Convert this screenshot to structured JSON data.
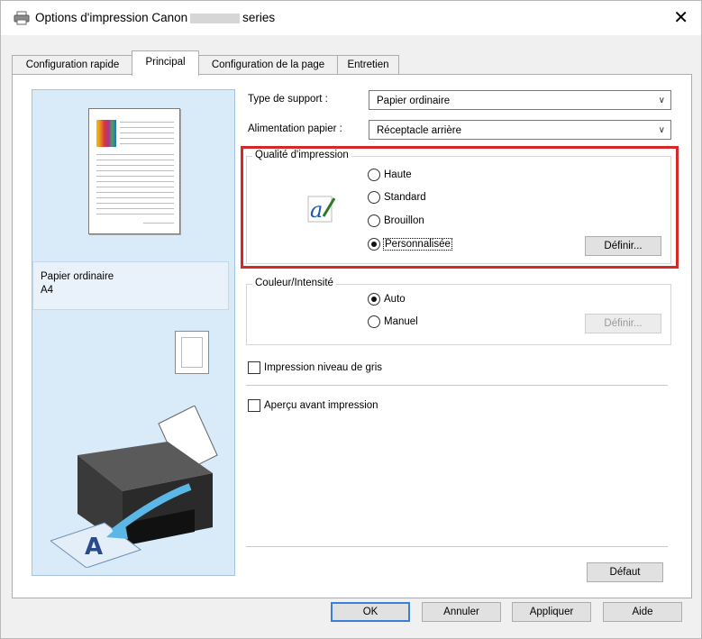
{
  "window": {
    "title_left": "Options d'impression Canon",
    "title_right": "series",
    "close_glyph": "✕"
  },
  "tabs": [
    {
      "label": "Configuration rapide",
      "active": false
    },
    {
      "label": "Principal",
      "active": true
    },
    {
      "label": "Configuration de la page",
      "active": false
    },
    {
      "label": "Entretien",
      "active": false
    }
  ],
  "preview": {
    "media_line1": "Papier ordinaire",
    "media_line2": "A4"
  },
  "settings": {
    "support_label": "Type de support :",
    "support_value": "Papier ordinaire",
    "feed_label": "Alimentation papier :",
    "feed_value": "Réceptacle arrière",
    "dropdown_glyph": "∨"
  },
  "quality": {
    "title": "Qualité d'impression",
    "options": [
      "Haute",
      "Standard",
      "Brouillon",
      "Personnalisée"
    ],
    "selected": "Personnalisée",
    "define_label": "Définir..."
  },
  "color": {
    "title": "Couleur/Intensité",
    "options": [
      "Auto",
      "Manuel"
    ],
    "selected": "Auto",
    "define_label": "Définir..."
  },
  "checkboxes": {
    "grayscale": "Impression niveau de gris",
    "preview": "Aperçu avant impression"
  },
  "buttons": {
    "defaults": "Défaut",
    "ok": "OK",
    "cancel": "Annuler",
    "apply": "Appliquer",
    "help": "Aide"
  },
  "colors": {
    "highlight": "#d72828",
    "preview_bg": "#d9eaf8",
    "focus_border": "#3c7fd6"
  },
  "icons": {
    "title": "printer-icon",
    "quality": "quality-pen-icon",
    "printer_illustration": "printer-illustration"
  }
}
